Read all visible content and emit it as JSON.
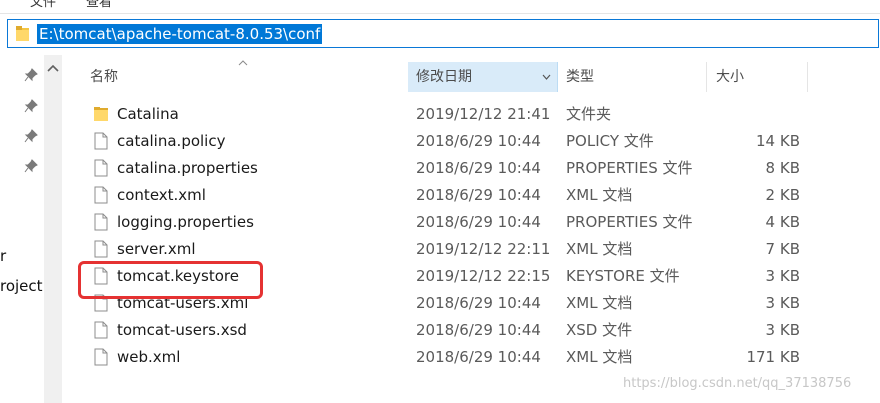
{
  "ribbon": {
    "item1": "文件",
    "item2": "查看"
  },
  "address": {
    "path": "E:\\tomcat\\apache-tomcat-8.0.53\\conf"
  },
  "nav": {
    "label1": "r",
    "label2": "roject"
  },
  "columns": {
    "name": "名称",
    "date": "修改日期",
    "type": "类型",
    "size": "大小"
  },
  "files": [
    {
      "name": "Catalina",
      "date": "2019/12/12 21:41",
      "type": "文件夹",
      "size": "",
      "icon": "folder-icon"
    },
    {
      "name": "catalina.policy",
      "date": "2018/6/29 10:44",
      "type": "POLICY 文件",
      "size": "14 KB",
      "icon": "file-icon"
    },
    {
      "name": "catalina.properties",
      "date": "2018/6/29 10:44",
      "type": "PROPERTIES 文件",
      "size": "8 KB",
      "icon": "file-icon"
    },
    {
      "name": "context.xml",
      "date": "2018/6/29 10:44",
      "type": "XML 文档",
      "size": "2 KB",
      "icon": "file-icon"
    },
    {
      "name": "logging.properties",
      "date": "2018/6/29 10:44",
      "type": "PROPERTIES 文件",
      "size": "4 KB",
      "icon": "file-icon"
    },
    {
      "name": "server.xml",
      "date": "2019/12/12 22:11",
      "type": "XML 文档",
      "size": "7 KB",
      "icon": "file-icon"
    },
    {
      "name": "tomcat.keystore",
      "date": "2019/12/12 22:15",
      "type": "KEYSTORE 文件",
      "size": "3 KB",
      "icon": "file-icon"
    },
    {
      "name": "tomcat-users.xml",
      "date": "2018/6/29 10:44",
      "type": "XML 文档",
      "size": "3 KB",
      "icon": "file-icon"
    },
    {
      "name": "tomcat-users.xsd",
      "date": "2018/6/29 10:44",
      "type": "XSD 文件",
      "size": "3 KB",
      "icon": "file-icon"
    },
    {
      "name": "web.xml",
      "date": "2018/6/29 10:44",
      "type": "XML 文档",
      "size": "171 KB",
      "icon": "file-icon"
    }
  ],
  "watermark": "https://blog.csdn.net/qq_37138756",
  "colors": {
    "selection": "#0078d7",
    "header_active": "#d9ebf9",
    "highlight": "#e53232",
    "folder": "#f4c542"
  }
}
